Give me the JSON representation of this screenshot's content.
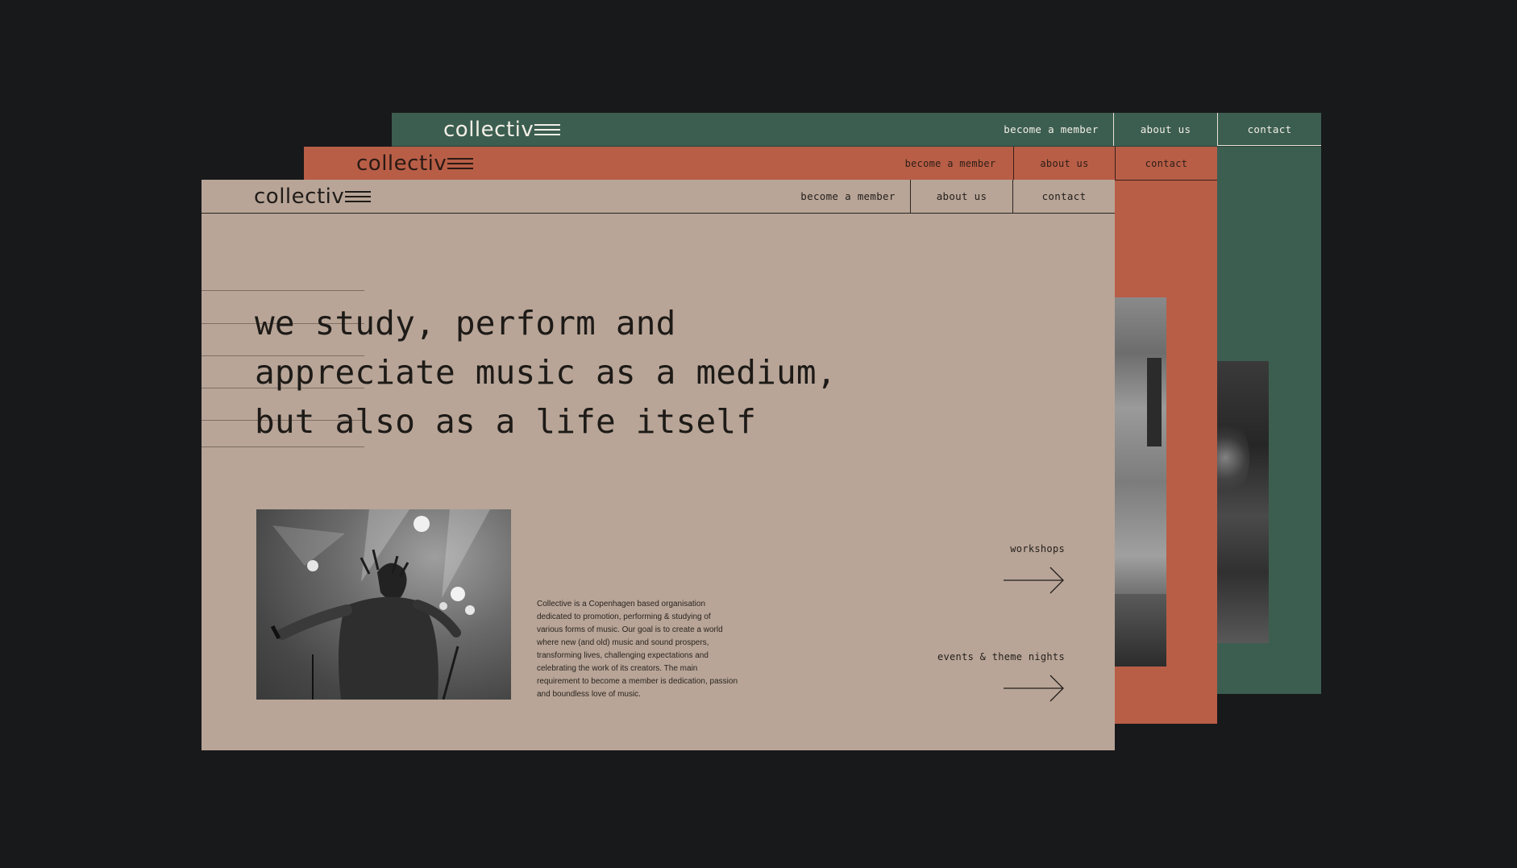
{
  "brand": {
    "logo_text": "collectiv"
  },
  "pages": {
    "green": {
      "nav": {
        "become": "become a member",
        "about": "about us",
        "contact": "contact"
      }
    },
    "orange": {
      "nav": {
        "become": "become a member",
        "about": "about us",
        "contact": "contact"
      }
    },
    "beige": {
      "nav": {
        "become": "become a member",
        "about": "about us",
        "contact": "contact"
      },
      "headline": [
        "we study, perform and",
        "appreciate music as a medium,",
        "but also as a life itself"
      ],
      "description": "Collective is a Copenhagen based organisation dedicated to promotion, performing & studying of various forms of music. Our goal is to create a world where new (and old) music and sound prospers, transforming lives, challenging expectations and celebrating the work of its creators. The main requirement to become a member is dedication, passion and boundless love of music.",
      "links": {
        "workshops": "workshops",
        "events": "events & theme nights"
      }
    }
  },
  "colors": {
    "background": "#18191b",
    "green": "#3c5e51",
    "orange": "#b85e47",
    "beige": "#b8a597",
    "ink": "#1d1a17"
  },
  "icons": {
    "arrow": "arrow-right-icon",
    "logo_mark": "triple-line-logo-mark"
  }
}
